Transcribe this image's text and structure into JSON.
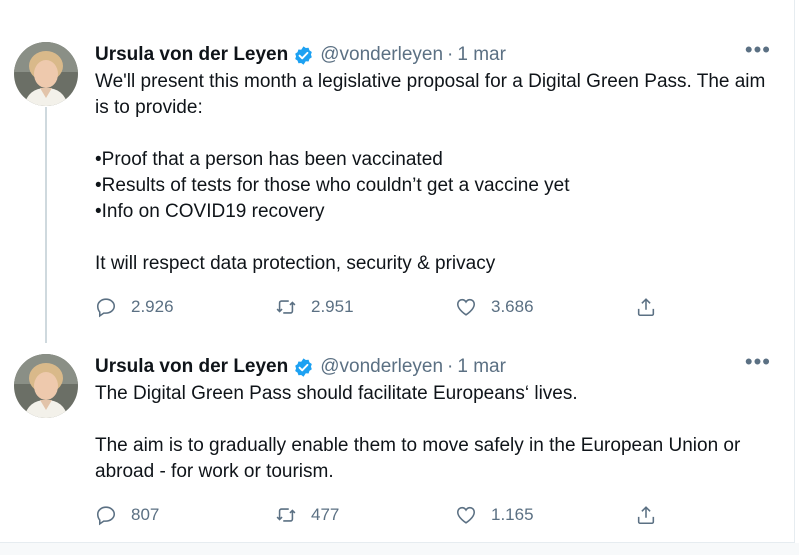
{
  "tweets": [
    {
      "author_name": "Ursula von der Leyen",
      "handle": "@vonderleyen",
      "separator": "·",
      "date": "1 mar",
      "more": "•••",
      "text": "We'll present this month a legislative proposal for a Digital Green Pass. The aim is to provide:\n\n•Proof that a person has been vaccinated\n•Results of tests for those who couldn’t get a vaccine yet\n•Info on COVID19 recovery\n\nIt will respect data protection, security & privacy",
      "replies": "2.926",
      "retweets": "2.951",
      "likes": "3.686"
    },
    {
      "author_name": "Ursula von der Leyen",
      "handle": "@vonderleyen",
      "separator": "·",
      "date": "1 mar",
      "more": "•••",
      "text": "The Digital Green Pass should facilitate Europeans‘ lives.\n\nThe aim is to gradually enable them to move safely in the European Union or abroad - for work or tourism.",
      "replies": "807",
      "retweets": "477",
      "likes": "1.165"
    }
  ],
  "icons": {
    "verified": "verified-badge-icon",
    "reply": "reply-icon",
    "retweet": "retweet-icon",
    "like": "heart-icon",
    "share": "share-icon"
  },
  "colors": {
    "text": "#0f1419",
    "secondary": "#5b7083",
    "verified": "#1da1f2",
    "thread_line": "#cfd9de"
  }
}
